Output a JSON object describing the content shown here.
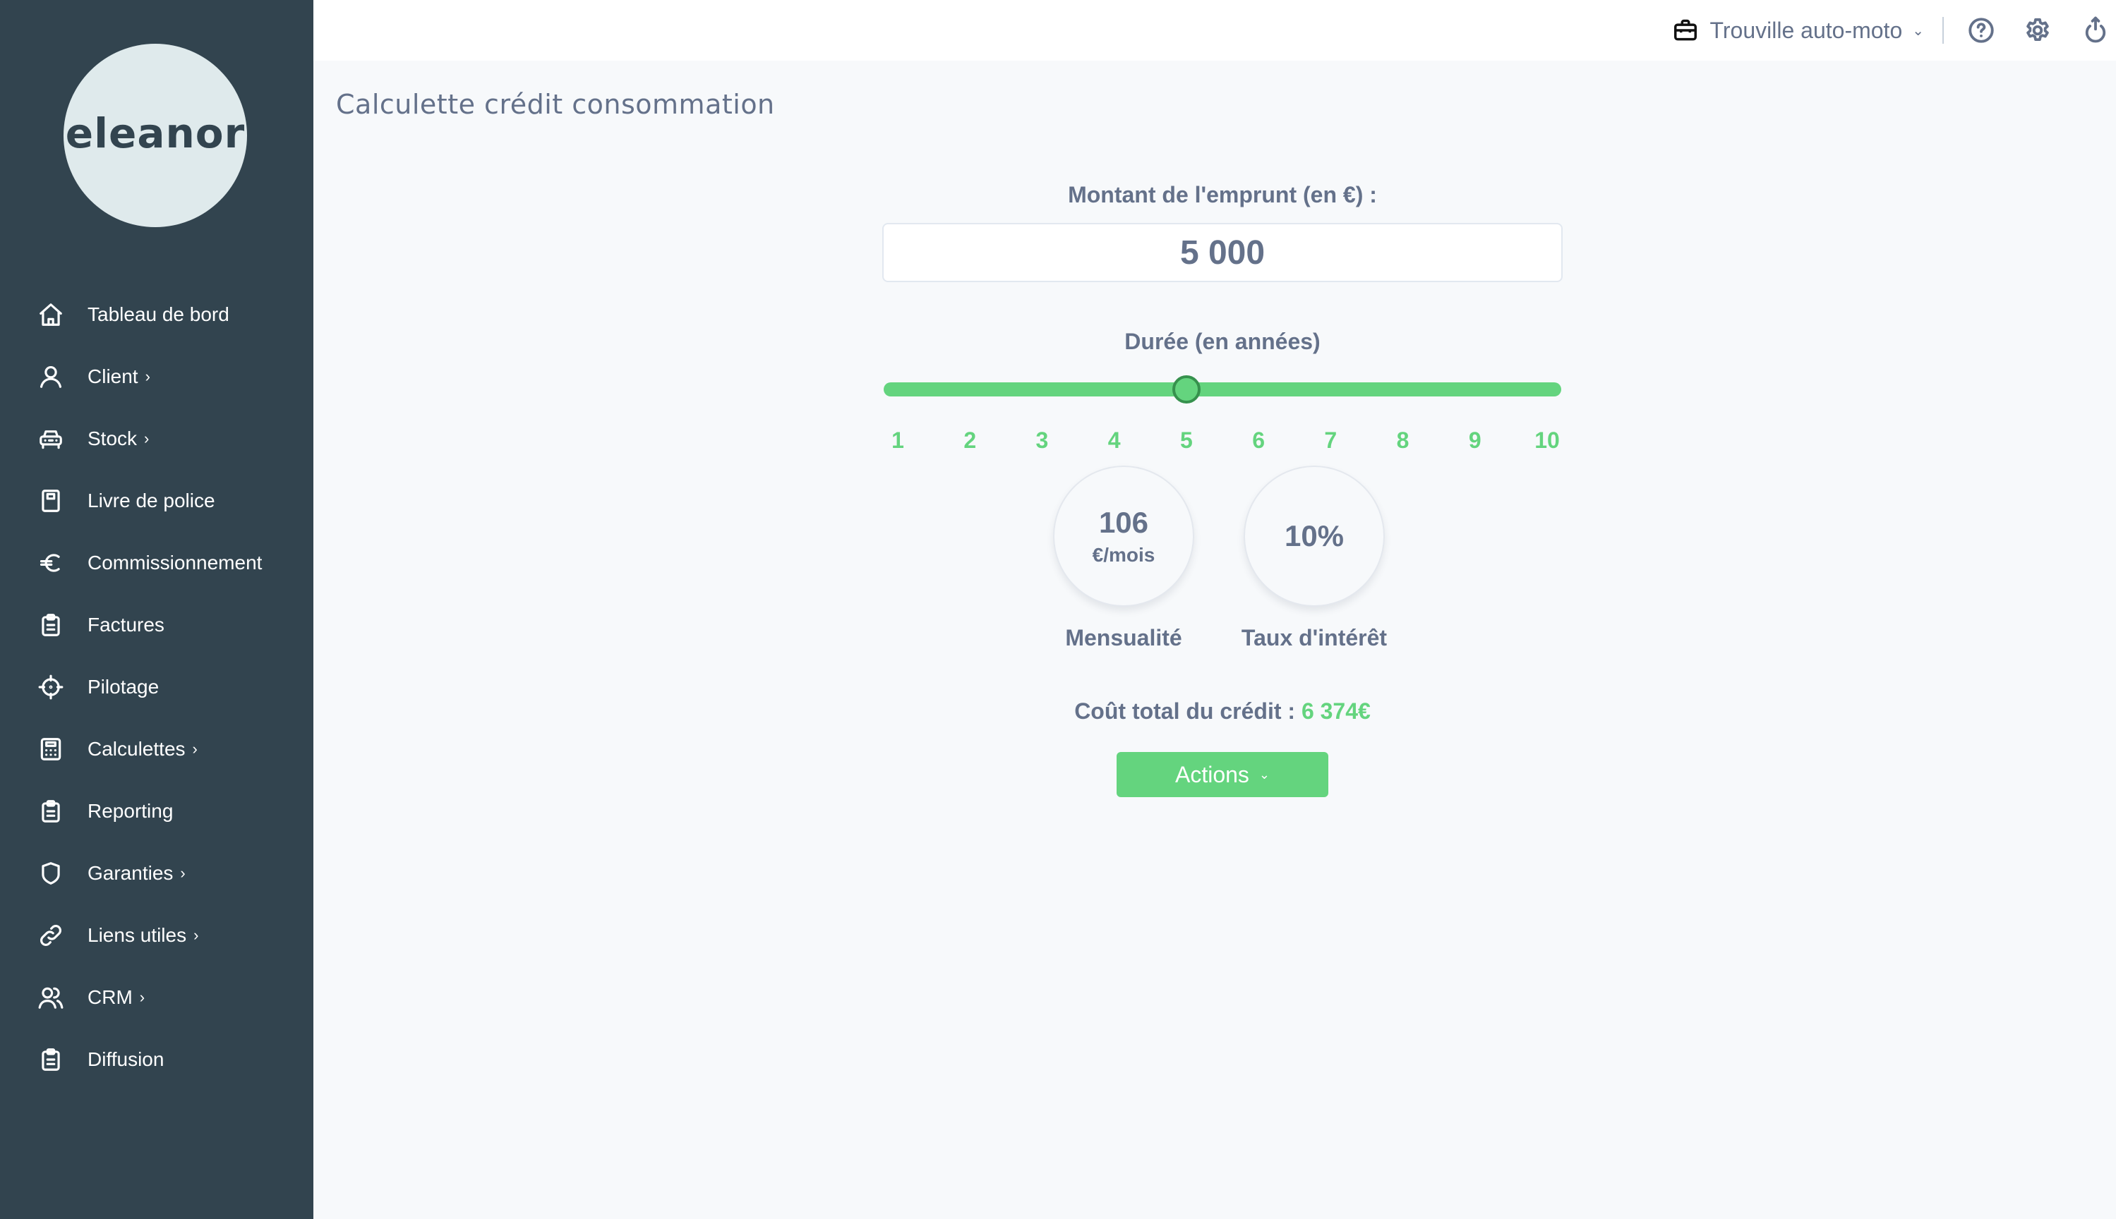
{
  "sidebar": {
    "logo_text": "eleanor",
    "items": [
      {
        "label": "Tableau de bord",
        "icon": "home-icon",
        "has_submenu": false
      },
      {
        "label": "Client",
        "icon": "user-icon",
        "has_submenu": true
      },
      {
        "label": "Stock",
        "icon": "car-icon",
        "has_submenu": true
      },
      {
        "label": "Livre de police",
        "icon": "book-icon",
        "has_submenu": false
      },
      {
        "label": "Commissionnement",
        "icon": "euro-icon",
        "has_submenu": false
      },
      {
        "label": "Factures",
        "icon": "clipboard-icon",
        "has_submenu": false
      },
      {
        "label": "Pilotage",
        "icon": "crosshair-icon",
        "has_submenu": false
      },
      {
        "label": "Calculettes",
        "icon": "calculator-icon",
        "has_submenu": true
      },
      {
        "label": "Reporting",
        "icon": "clipboard-icon",
        "has_submenu": false
      },
      {
        "label": "Garanties",
        "icon": "shield-icon",
        "has_submenu": true
      },
      {
        "label": "Liens utiles",
        "icon": "link-icon",
        "has_submenu": true
      },
      {
        "label": "CRM",
        "icon": "users-icon",
        "has_submenu": true
      },
      {
        "label": "Diffusion",
        "icon": "clipboard-icon",
        "has_submenu": false
      }
    ],
    "submenu_chevron": "›"
  },
  "topbar": {
    "agency_name": "Trouville auto-moto",
    "agency_caret": "⌄",
    "icons": [
      "help-icon",
      "settings-icon",
      "logout-icon"
    ]
  },
  "page": {
    "title": "Calculette crédit consommation"
  },
  "calculator": {
    "amount_label": "Montant de l'emprunt (en €) :",
    "amount_value": "5 000",
    "duration_label": "Durée (en années)",
    "duration_ticks": [
      "1",
      "2",
      "3",
      "4",
      "5",
      "6",
      "7",
      "8",
      "9",
      "10"
    ],
    "duration_min": 1,
    "duration_max": 10,
    "duration_value": 5,
    "monthly_value": "106",
    "monthly_unit": "€/mois",
    "monthly_label": "Mensualité",
    "rate_value": "10%",
    "rate_label": "Taux d'intérêt",
    "total_label": "Coût total du crédit :",
    "total_value": "6 374€",
    "actions_label": "Actions",
    "actions_caret": "⌄"
  },
  "colors": {
    "sidebar_bg": "#32444f",
    "accent_green": "#64d47e",
    "text_slate": "#64718a",
    "page_bg": "#f7f9fb"
  }
}
